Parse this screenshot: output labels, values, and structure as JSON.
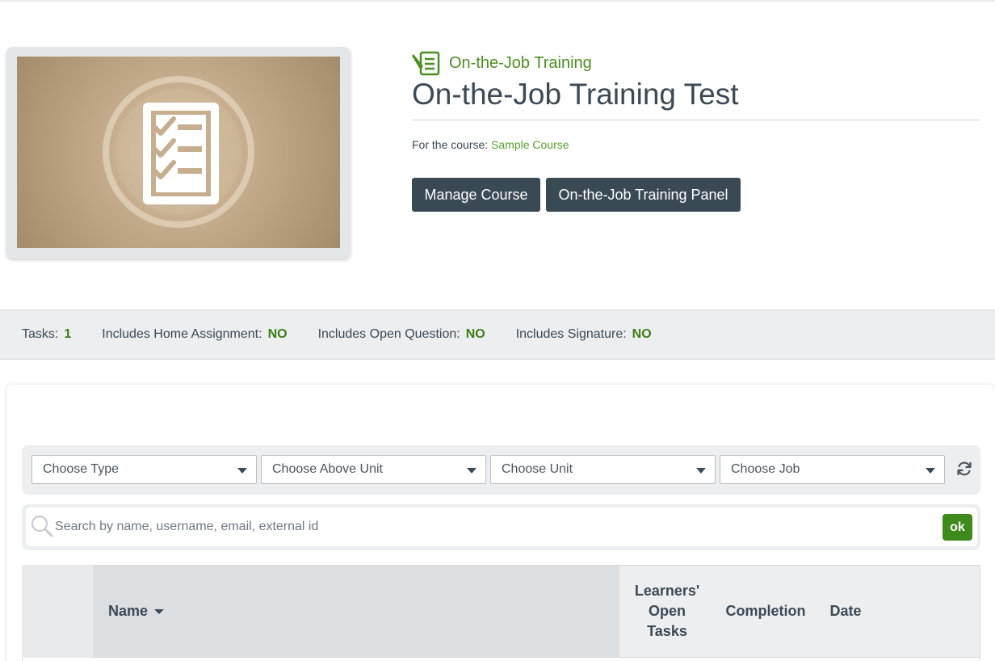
{
  "header": {
    "category_label": "On-the-Job Training",
    "category_icon": "checklist-pen-icon",
    "title": "On-the-Job Training Test",
    "course_prefix": "For the course:",
    "course_name": "Sample Course",
    "thumbnail_icon": "checklist-icon"
  },
  "actions": {
    "manage_course": "Manage Course",
    "ojt_panel": "On-the-Job Training Panel"
  },
  "stats": [
    {
      "label": "Tasks:",
      "value": "1"
    },
    {
      "label": "Includes Home Assignment:",
      "value": "NO"
    },
    {
      "label": "Includes Open Question:",
      "value": "NO"
    },
    {
      "label": "Includes Signature:",
      "value": "NO"
    }
  ],
  "filters": {
    "type": "Choose Type",
    "above_unit": "Choose Above Unit",
    "unit": "Choose Unit",
    "job": "Choose Job",
    "refresh_icon": "refresh-icon"
  },
  "search": {
    "placeholder": "Search by name, username, email, external id",
    "value": "",
    "submit": "ok"
  },
  "table": {
    "columns": {
      "name": "Name",
      "open_tasks": "Learners' Open Tasks",
      "completion": "Completion",
      "date": "Date"
    }
  },
  "colors": {
    "accent_green": "#4a8f1f",
    "dark_button": "#3a4a55",
    "ok_button": "#3f8a1c"
  }
}
